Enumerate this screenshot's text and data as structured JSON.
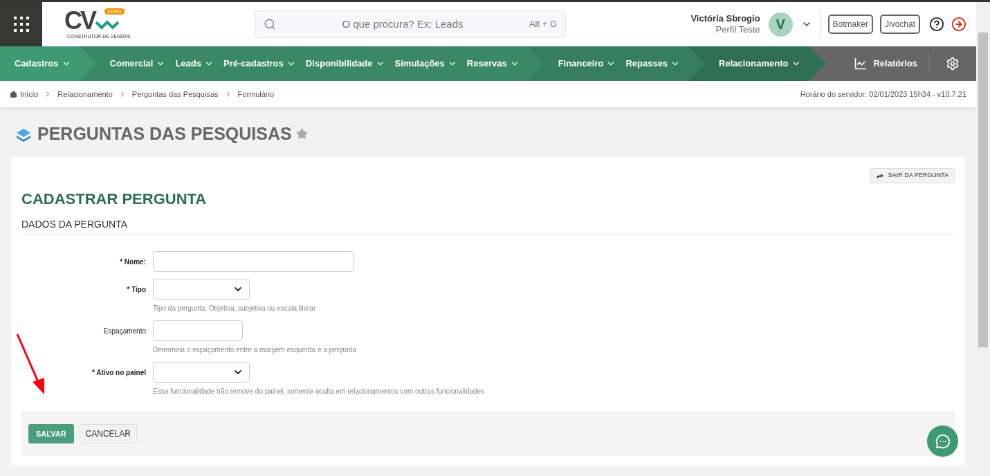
{
  "header": {
    "logo": {
      "letters": "CV",
      "badge": "DEMO",
      "tagline": "CONSTRUTOR DE VENDAS"
    },
    "search": {
      "placeholder": "O que procura? Ex: Leads",
      "shortcut": "Alt + G"
    },
    "user": {
      "name": "Victória Sbrogio",
      "profile": "Perfil Teste",
      "initial": "V"
    },
    "buttons": [
      "Botmaker",
      "Jivochat"
    ]
  },
  "nav": {
    "groups": [
      {
        "color": "#3f9a74",
        "items": [
          "Cadastros"
        ]
      },
      {
        "color": "#3a8866",
        "items": [
          "Comercial",
          "Leads",
          "Pré-cadastros",
          "Disponibilidade",
          "Simulações",
          "Reservas"
        ]
      },
      {
        "color": "#367e5f",
        "items": [
          "Financeiro",
          "Repasses"
        ]
      },
      {
        "color": "#2f6f53",
        "items": [
          "Relacionamento"
        ]
      }
    ],
    "reports": "Relatórios"
  },
  "breadcrumb": [
    "Início",
    "Relacionamento",
    "Perguntas das Pesquisas",
    "Formulário"
  ],
  "server_time": "Horário do servidor: 02/01/2023 15h34 - v10.7.21",
  "page_title": "PERGUNTAS DAS PESQUISAS",
  "card": {
    "exit_button": "SAIR DA PERGUNTA",
    "title": "CADASTRAR PERGUNTA",
    "section": "DADOS DA PERGUNTA",
    "fields": [
      {
        "kind": "text",
        "label": "* Nome:",
        "required": true
      },
      {
        "kind": "select",
        "label": "* Tipo",
        "required": true,
        "hint": "Tipo da pergunta: Objetiva, subjetiva ou escala linear"
      },
      {
        "kind": "number",
        "label": "Espaçamento",
        "required": false,
        "hint": "Determina o espaçamento entre a margem esquerda e a pergunta"
      },
      {
        "kind": "select",
        "label": "* Ativo no painel",
        "required": true,
        "hint": "Essa funcionalidade não remove do painel, somente oculta em relacionamentos com outras funcionalidades"
      }
    ],
    "buttons": [
      {
        "label": "SALVAR",
        "kind": "primary"
      },
      {
        "label": "CANCELAR",
        "kind": "secondary"
      }
    ]
  }
}
